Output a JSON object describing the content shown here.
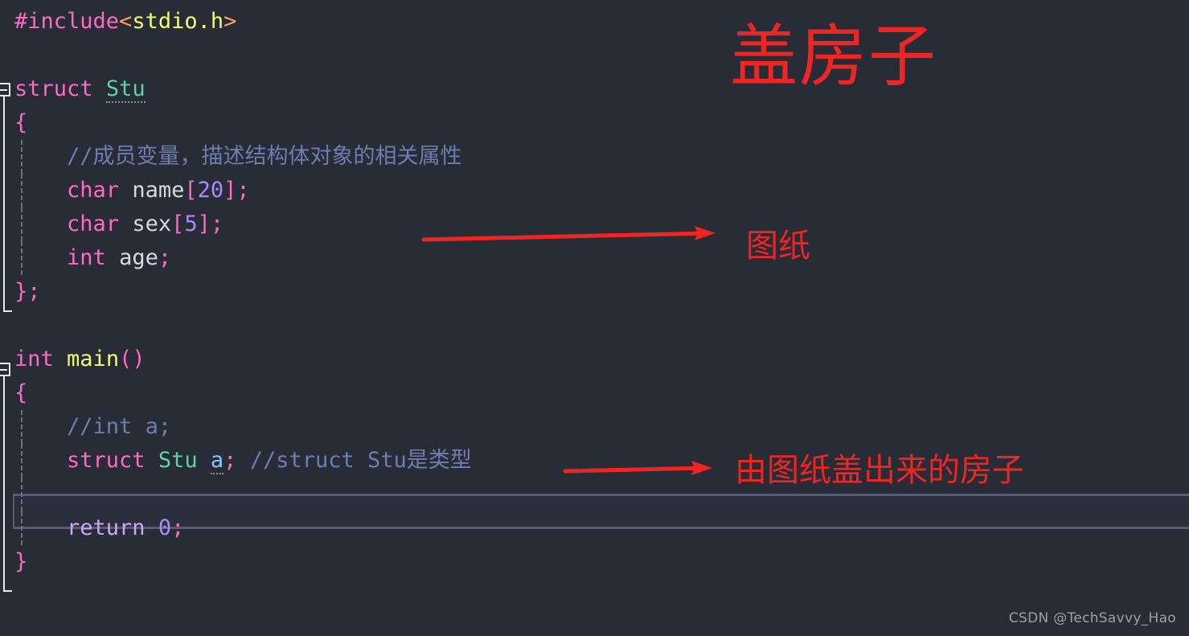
{
  "editor": {
    "background": "#282c36",
    "font_size_px": 27,
    "lines": [
      {
        "n": 1,
        "indent": 0,
        "fold": "none",
        "guide": false,
        "tokens": [
          {
            "t": "#include",
            "c": "pre"
          },
          {
            "t": "<",
            "c": "angle"
          },
          {
            "t": "stdio.h",
            "c": "hdr"
          },
          {
            "t": ">",
            "c": "angle"
          }
        ]
      },
      {
        "n": 2,
        "indent": 0,
        "fold": "none",
        "guide": false,
        "tokens": []
      },
      {
        "n": 3,
        "indent": 0,
        "fold": "open",
        "guide": false,
        "tokens": [
          {
            "t": "struct",
            "c": "kw"
          },
          {
            "t": " ",
            "c": "plain"
          },
          {
            "t": "Stu",
            "c": "type",
            "underline": "dotted"
          }
        ]
      },
      {
        "n": 4,
        "indent": 0,
        "fold": "bar",
        "guide": false,
        "tokens": [
          {
            "t": "{",
            "c": "brace"
          }
        ]
      },
      {
        "n": 5,
        "indent": 1,
        "fold": "bar",
        "guide": true,
        "tokens": [
          {
            "t": "//成员变量，描述结构体对象的相关属性",
            "c": "cmt"
          }
        ]
      },
      {
        "n": 6,
        "indent": 1,
        "fold": "bar",
        "guide": true,
        "tokens": [
          {
            "t": "char",
            "c": "kw"
          },
          {
            "t": " ",
            "c": "plain"
          },
          {
            "t": "name",
            "c": "ident"
          },
          {
            "t": "[",
            "c": "brk"
          },
          {
            "t": "20",
            "c": "num"
          },
          {
            "t": "]",
            "c": "brk"
          },
          {
            "t": ";",
            "c": "brk"
          }
        ]
      },
      {
        "n": 7,
        "indent": 1,
        "fold": "bar",
        "guide": true,
        "tokens": [
          {
            "t": "char",
            "c": "kw"
          },
          {
            "t": " ",
            "c": "plain"
          },
          {
            "t": "sex",
            "c": "ident"
          },
          {
            "t": "[",
            "c": "brk"
          },
          {
            "t": "5",
            "c": "num"
          },
          {
            "t": "]",
            "c": "brk"
          },
          {
            "t": ";",
            "c": "brk"
          }
        ]
      },
      {
        "n": 8,
        "indent": 1,
        "fold": "bar",
        "guide": true,
        "tokens": [
          {
            "t": "int",
            "c": "kw"
          },
          {
            "t": " ",
            "c": "plain"
          },
          {
            "t": "age",
            "c": "ident"
          },
          {
            "t": ";",
            "c": "brk"
          }
        ]
      },
      {
        "n": 9,
        "indent": 0,
        "fold": "end",
        "guide": false,
        "tokens": [
          {
            "t": "}",
            "c": "brace"
          },
          {
            "t": ";",
            "c": "brk"
          }
        ]
      },
      {
        "n": 10,
        "indent": 0,
        "fold": "none",
        "guide": false,
        "tokens": []
      },
      {
        "n": 11,
        "indent": 0,
        "fold": "open",
        "guide": false,
        "tokens": [
          {
            "t": "int",
            "c": "kw"
          },
          {
            "t": " ",
            "c": "plain"
          },
          {
            "t": "main",
            "c": "fn"
          },
          {
            "t": "()",
            "c": "paren"
          }
        ]
      },
      {
        "n": 12,
        "indent": 0,
        "fold": "bar",
        "guide": false,
        "tokens": [
          {
            "t": "{",
            "c": "brace"
          }
        ]
      },
      {
        "n": 13,
        "indent": 1,
        "fold": "bar",
        "guide": true,
        "tokens": [
          {
            "t": "//int a;",
            "c": "cmt"
          }
        ]
      },
      {
        "n": 14,
        "indent": 1,
        "fold": "bar",
        "guide": true,
        "tokens": [
          {
            "t": "struct",
            "c": "kw"
          },
          {
            "t": " ",
            "c": "plain"
          },
          {
            "t": "Stu",
            "c": "type"
          },
          {
            "t": " ",
            "c": "plain"
          },
          {
            "t": "a",
            "c": "var",
            "underline": "dotted"
          },
          {
            "t": ";",
            "c": "brk"
          },
          {
            "t": " ",
            "c": "plain"
          },
          {
            "t": "//struct Stu是类型",
            "c": "cmt"
          }
        ]
      },
      {
        "n": 15,
        "indent": 1,
        "fold": "bar",
        "guide": true,
        "caret": true,
        "tokens": []
      },
      {
        "n": 16,
        "indent": 1,
        "fold": "bar",
        "guide": true,
        "tokens": [
          {
            "t": "return",
            "c": "ret"
          },
          {
            "t": " ",
            "c": "plain"
          },
          {
            "t": "0",
            "c": "num"
          },
          {
            "t": ";",
            "c": "brk"
          }
        ]
      },
      {
        "n": 17,
        "indent": 0,
        "fold": "end",
        "guide": false,
        "tokens": [
          {
            "t": "}",
            "c": "brace"
          }
        ]
      }
    ]
  },
  "annotations": {
    "color": "#ee2622",
    "title": "盖房子",
    "blueprint_label": "图纸",
    "house_label": "由图纸盖出来的房子"
  },
  "watermark": {
    "text": "CSDN @TechSavvy_Hao"
  }
}
